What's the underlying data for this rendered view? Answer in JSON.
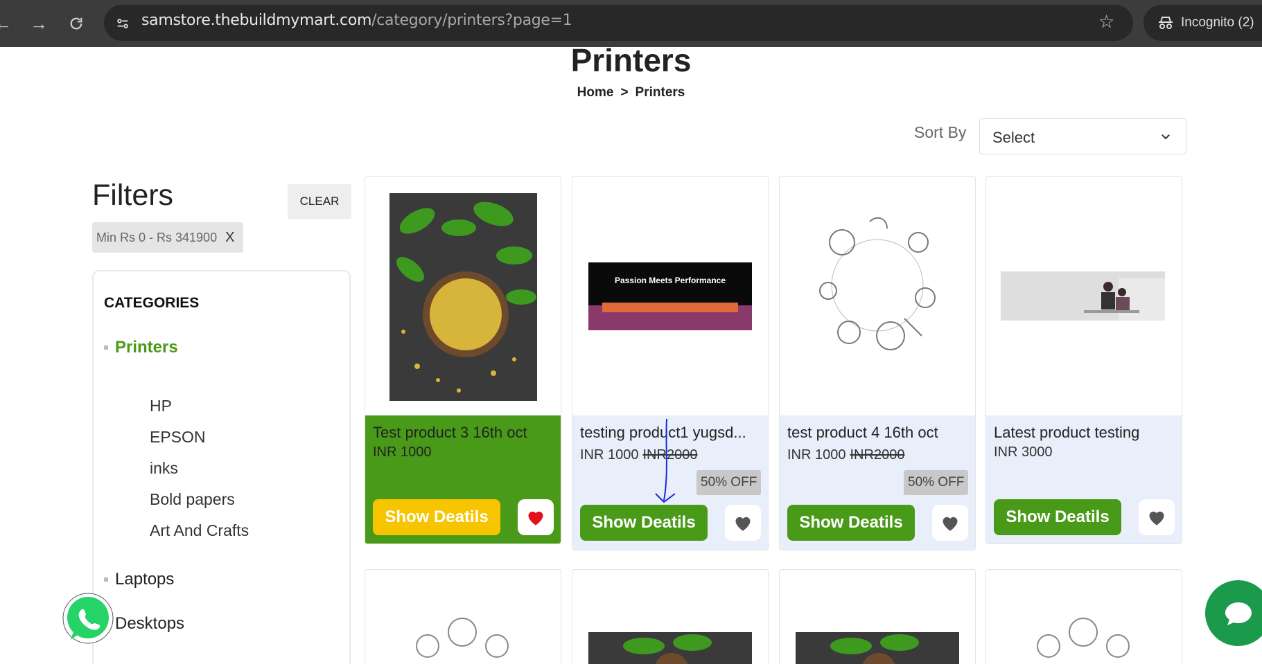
{
  "browser": {
    "url_host": "samstore.thebuildmymart.com",
    "url_path": "/category/printers?page=1",
    "incognito_label": "Incognito (2)"
  },
  "page": {
    "title": "Printers",
    "breadcrumb": [
      "Home",
      "Printers"
    ],
    "breadcrumb_sep": ">",
    "sort_label": "Sort By",
    "sort_value": "Select"
  },
  "filters": {
    "heading": "Filters",
    "clear_label": "CLEAR",
    "chip_label": "Min Rs 0 - Rs 341900",
    "chip_close": "X",
    "categories_heading": "CATEGORIES",
    "categories": [
      {
        "label": "Printers",
        "active": true,
        "children": [
          "HP",
          "EPSON",
          "inks",
          "Bold papers",
          "Art And Crafts"
        ]
      },
      {
        "label": "Laptops",
        "active": false
      },
      {
        "label": "Desktops",
        "active": false
      }
    ]
  },
  "products": [
    {
      "name": "Test product 3 16th oct",
      "price": "INR 1000",
      "old_price": "",
      "discount": "",
      "button": "Show Deatils",
      "wishlisted": true,
      "image": "fenugreek-seeds-photo"
    },
    {
      "name": "testing product1 yugsd...",
      "price": "INR 1000",
      "old_price": "INR2000",
      "discount": "50% OFF",
      "button": "Show Deatils",
      "wishlisted": false,
      "image": "laptop-banner-photo",
      "banner_text": "Passion Meets Performance"
    },
    {
      "name": "test product 4 16th oct",
      "price": "INR 1000",
      "old_price": "INR2000",
      "discount": "50% OFF",
      "button": "Show Deatils",
      "wishlisted": false,
      "image": "vegetable-sketch-frame"
    },
    {
      "name": "Latest product testing",
      "price": "INR 3000",
      "old_price": "",
      "discount": "",
      "button": "Show Deatils",
      "wishlisted": false,
      "image": "office-people-photo"
    }
  ],
  "colors": {
    "green": "#4a9a19",
    "yellow": "#f7c500",
    "active_card_bg": "#4a9a19",
    "card_foot_bg": "#e9eefb",
    "heart_red": "#e3101e"
  }
}
